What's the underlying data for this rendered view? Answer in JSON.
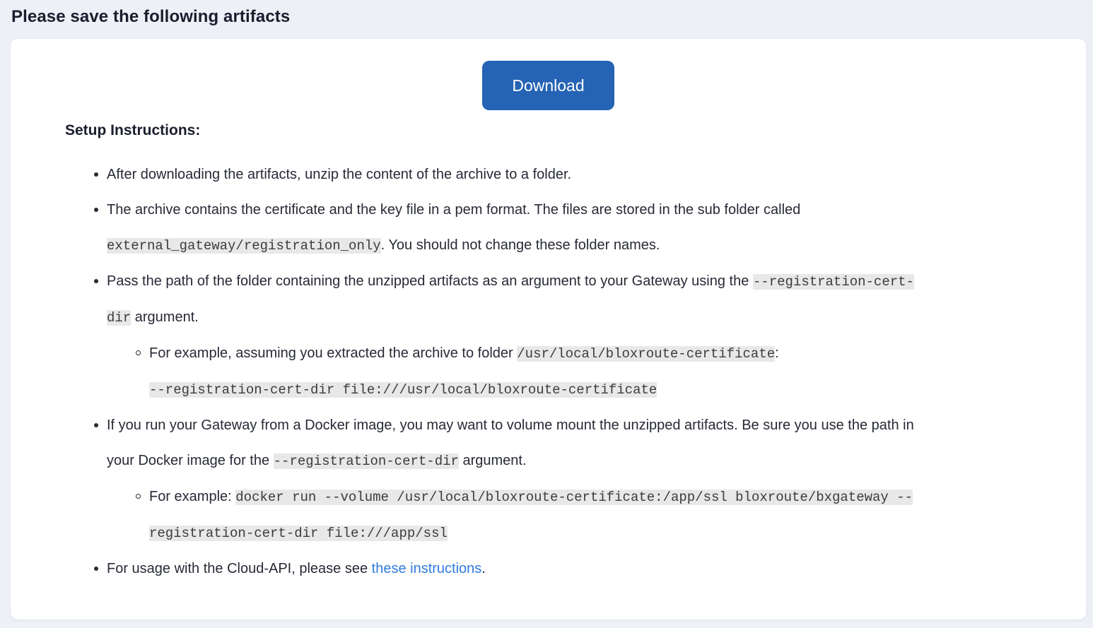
{
  "page": {
    "heading": "Please save the following artifacts"
  },
  "card": {
    "download_label": "Download",
    "setup_title": "Setup Instructions:",
    "items": [
      {
        "text": "After downloading the artifacts, unzip the content of the archive to a folder."
      },
      {
        "text_before": "The archive contains the certificate and the key file in a pem format. The files are stored in the sub folder called ",
        "code": "external_gateway/registration_only",
        "text_after": ". You should not change these folder names."
      },
      {
        "text_before": "Pass the path of the folder containing the unzipped artifacts as an argument to your Gateway using the ",
        "code": "--registration-cert-dir",
        "text_after": " argument.",
        "example": {
          "text_before": "For example, assuming you extracted the archive to folder ",
          "code_path": "/usr/local/bloxroute-certificate",
          "colon": ":",
          "code_command": "--registration-cert-dir file:///usr/local/bloxroute-certificate"
        }
      },
      {
        "text_before": "If you run your Gateway from a Docker image, you may want to volume mount the unzipped artifacts. Be sure you use the path in your Docker image for the ",
        "code": "--registration-cert-dir",
        "text_after": " argument.",
        "example": {
          "text_before": "For example: ",
          "code_command": "docker run --volume /usr/local/bloxroute-certificate:/app/ssl bloxroute/bxgateway --registration-cert-dir file:///app/ssl"
        }
      },
      {
        "text_before": "For usage with the Cloud-API, please see ",
        "link": "these instructions",
        "text_after": "."
      }
    ]
  },
  "colors": {
    "page_background": "#edf0f7",
    "button_background": "#2563b4",
    "link": "#2f7be0",
    "code_background": "#e8e8e8"
  }
}
